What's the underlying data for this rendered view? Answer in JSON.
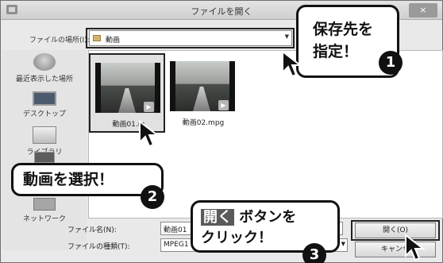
{
  "window": {
    "title": "ファイルを開く",
    "close_label": "×"
  },
  "location": {
    "label": "ファイルの場所(I):",
    "value": "動画"
  },
  "places": [
    {
      "label": "最近表示した場所",
      "icon": "recent-places-icon"
    },
    {
      "label": "デスクトップ",
      "icon": "desktop-icon"
    },
    {
      "label": "ライブラリ",
      "icon": "library-icon"
    },
    {
      "label": "",
      "icon": "pc-icon"
    },
    {
      "label": "ネットワーク",
      "icon": "network-icon"
    }
  ],
  "files": [
    {
      "name": "動画01.m",
      "selected": true
    },
    {
      "name": "動画02.mpg",
      "selected": false
    }
  ],
  "filename": {
    "label": "ファイル名(N):",
    "value": "動画01"
  },
  "filetype": {
    "label": "ファイルの種類(T):",
    "value": "MPEG1"
  },
  "buttons": {
    "open": "開く(O)",
    "cancel": "キャンセ"
  },
  "callouts": {
    "folder_line1": "保存先を",
    "folder_line2": "指定！",
    "select": "動画を選択！",
    "open_word": "開く",
    "open_rest": " ボタンを",
    "open_line2": "クリック！",
    "step1": "1",
    "step2": "2",
    "step3": "3"
  }
}
